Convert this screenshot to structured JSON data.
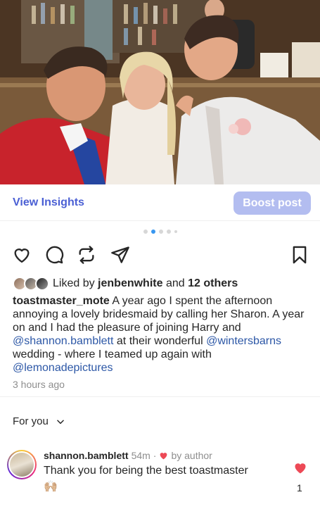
{
  "post": {
    "view_insights_label": "View Insights",
    "boost_label": "Boost post",
    "carousel": {
      "count": 5,
      "active_index": 1
    },
    "likes": {
      "prefix": "Liked by ",
      "user": "jenbenwhite",
      "middle": " and ",
      "others": "12 others"
    },
    "caption": {
      "username": "toastmaster_mote",
      "text_1": " A year ago I spent the afternoon annoying a lovely bridesmaid by calling her Sharon. A year on and I had the pleasure of joining Harry and ",
      "mention_1": "@shannon.bamblett",
      "text_2": " at their wonderful ",
      "mention_2": "@wintersbarns",
      "text_3": " wedding - where I teamed up again with ",
      "mention_3": "@lemonadepictures"
    },
    "timestamp": "3 hours ago"
  },
  "comments_section": {
    "filter_label": "For you",
    "comment": {
      "username": "shannon.bamblett",
      "time": "54m",
      "separator": "·",
      "badge": "by author",
      "text": "Thank you for being the best toastmaster",
      "emoji": "🙌🏼",
      "like_count": "1"
    }
  },
  "colors": {
    "accent_blue": "#4a5fd4",
    "boost_bg": "#b3bdf0",
    "mention": "#2c57a6",
    "heart_red": "#ed4956",
    "dot_active": "#3897f0"
  },
  "icons": [
    "heart-icon",
    "comment-icon",
    "repost-icon",
    "share-icon",
    "bookmark-icon",
    "chevron-down-icon",
    "small-heart-icon"
  ]
}
